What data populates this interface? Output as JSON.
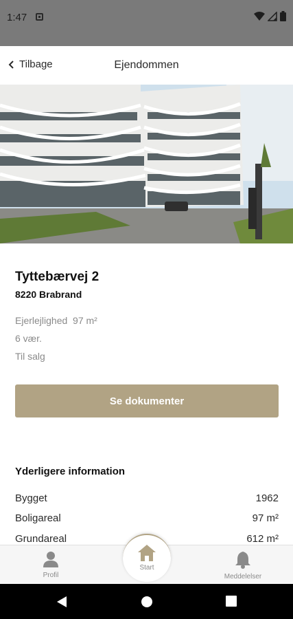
{
  "status_bar": {
    "time": "1:47"
  },
  "header": {
    "back_label": "Tilbage",
    "title": "Ejendommen"
  },
  "property": {
    "address": "Tyttebærvej 2",
    "city": "8220 Brabrand",
    "type_size": "Ejerlejlighed  97 m²",
    "rooms": "6 vær.",
    "status": "Til salg"
  },
  "documents_button": "Se dokumenter",
  "info": {
    "title": "Yderligere information",
    "rows": [
      {
        "label": "Bygget",
        "value": "1962"
      },
      {
        "label": "Boligareal",
        "value": "97 m²"
      },
      {
        "label": "Grundareal",
        "value": "612 m²"
      }
    ]
  },
  "bottom_nav": {
    "profile": "Profil",
    "start": "Start",
    "notifications": "Meddelelser"
  },
  "colors": {
    "accent": "#b1a384",
    "status_bar": "#7a7a7a"
  }
}
